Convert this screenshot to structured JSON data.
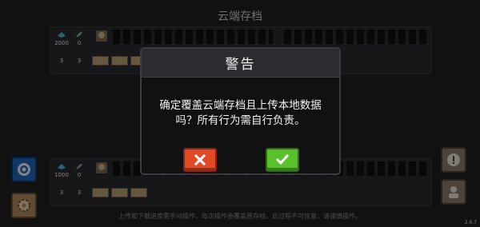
{
  "screen_title": "云端存档",
  "slot1": {
    "stat_a": "2000",
    "stat_b": "0",
    "row2_a": "3",
    "row2_b": "3"
  },
  "slot2": {
    "stat_a": "1000",
    "stat_b": "0",
    "row2_a": "3",
    "row2_b": "3"
  },
  "dialog": {
    "title": "警告",
    "message_line1": "确定覆盖云端存档且上传本地数据",
    "message_line2": "吗？所有行为需自行负责。"
  },
  "footer_text": "上传和下载进度需手动操作，每次操作会覆盖原存档。此过程不可恢复，请谨慎操作。",
  "version": "2.6.7",
  "colors": {
    "cancel": "#e24a26",
    "confirm": "#59c12b",
    "cloud_button": "#1f67b8"
  }
}
